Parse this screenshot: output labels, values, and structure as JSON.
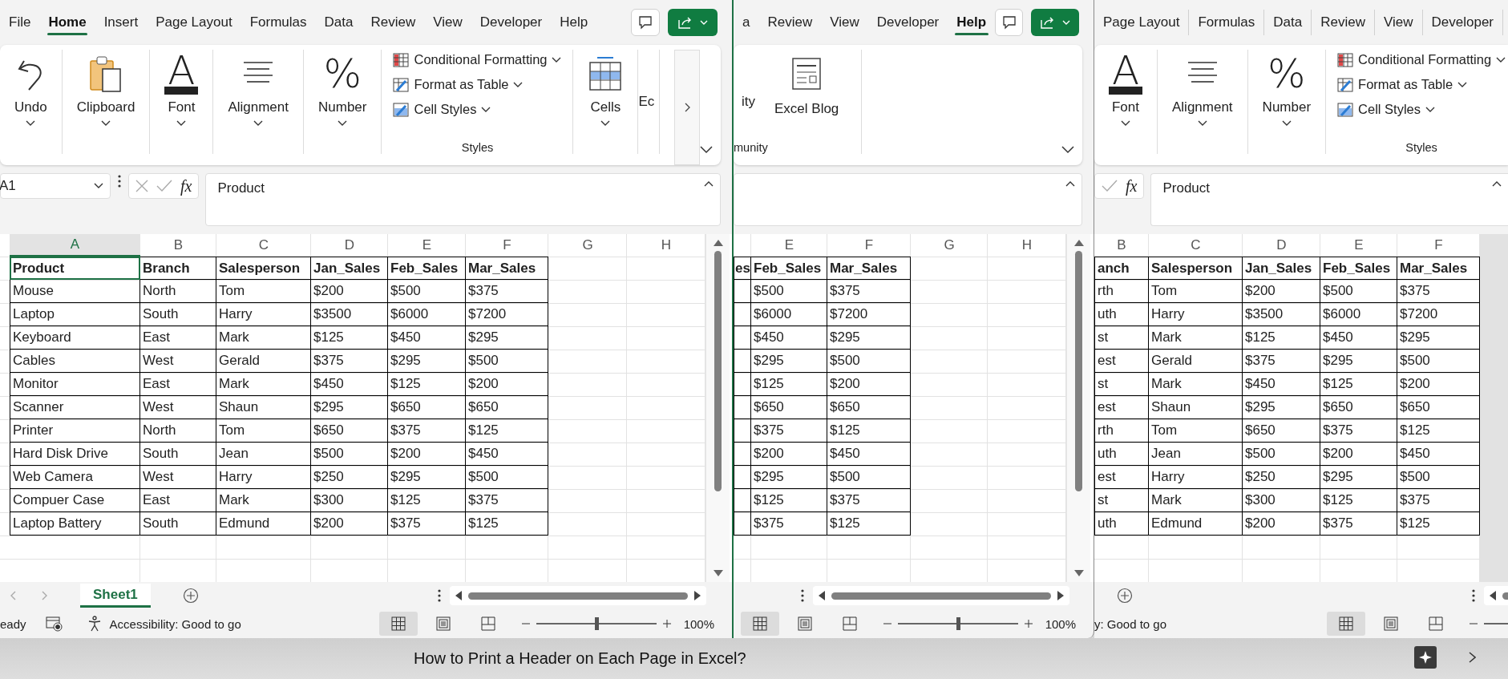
{
  "windows": [
    {
      "active": true,
      "tabs": [
        {
          "label": "File",
          "selected": false
        },
        {
          "label": "Home",
          "selected": true
        },
        {
          "label": "Insert",
          "selected": false
        },
        {
          "label": "Page Layout",
          "selected": false
        },
        {
          "label": "Formulas",
          "selected": false
        },
        {
          "label": "Data",
          "selected": false
        },
        {
          "label": "Review",
          "selected": false
        },
        {
          "label": "View",
          "selected": false
        },
        {
          "label": "Developer",
          "selected": false
        },
        {
          "label": "Help",
          "selected": false
        }
      ],
      "toolbar_buttons": [
        {
          "kind": "comment"
        },
        {
          "kind": "share"
        }
      ],
      "ribbon": [
        {
          "kind": "undo",
          "label": "Undo"
        },
        {
          "kind": "clipboard",
          "label": "Clipboard"
        },
        {
          "kind": "font",
          "label": "Font",
          "glyph": "A"
        },
        {
          "kind": "alignment",
          "label": "Alignment"
        },
        {
          "kind": "number",
          "label": "Number",
          "glyph": "%"
        },
        {
          "kind": "group",
          "label": "Styles",
          "items": [
            {
              "kind": "conditional",
              "label": "Conditional Formatting"
            },
            {
              "kind": "table",
              "label": "Format as Table"
            },
            {
              "kind": "cellstyles",
              "label": "Cell Styles"
            }
          ]
        },
        {
          "kind": "cells",
          "label": "Cells"
        },
        {
          "kind": "partial",
          "label": "Ec"
        }
      ],
      "ribbon_scroll": true,
      "ribbon_collapse": true,
      "formula_bar": {
        "kind": "full",
        "name_box": "A1",
        "fx": "fx",
        "value": "Product"
      },
      "column_letters": [
        {
          "label": "A",
          "selected": true
        },
        {
          "label": "B",
          "selected": false
        },
        {
          "label": "C",
          "selected": false
        },
        {
          "label": "D",
          "selected": false
        },
        {
          "label": "E",
          "selected": false
        },
        {
          "label": "F",
          "selected": false
        },
        {
          "label": "G",
          "selected": false
        },
        {
          "label": "H",
          "selected": false
        }
      ],
      "table": {
        "header": [
          {
            "text": "Product",
            "selected": true
          },
          {
            "text": "Branch",
            "selected": false
          },
          {
            "text": "Salesperson",
            "selected": false
          },
          {
            "text": "Jan_Sales",
            "selected": false
          },
          {
            "text": "Feb_Sales",
            "selected": false
          },
          {
            "text": "Mar_Sales",
            "selected": false
          }
        ],
        "rows": [
          [
            "Mouse",
            "North",
            "Tom",
            "$200",
            "$500",
            "$375"
          ],
          [
            "Laptop",
            "South",
            "Harry",
            "$3500",
            "$6000",
            "$7200"
          ],
          [
            "Keyboard",
            "East",
            "Mark",
            "$125",
            "$450",
            "$295"
          ],
          [
            "Cables",
            "West",
            "Gerald",
            "$375",
            "$295",
            "$500"
          ],
          [
            "Monitor",
            "East",
            "Mark",
            "$450",
            "$125",
            "$200"
          ],
          [
            "Scanner",
            "West",
            "Shaun",
            "$295",
            "$650",
            "$650"
          ],
          [
            "Printer",
            "North",
            "Tom",
            "$650",
            "$375",
            "$125"
          ],
          [
            "Hard Disk Drive",
            "South",
            "Jean",
            "$500",
            "$200",
            "$450"
          ],
          [
            "Web Camera",
            "West",
            "Harry",
            "$250",
            "$295",
            "$500"
          ],
          [
            "Compuer Case",
            "East",
            "Mark",
            "$300",
            "$125",
            "$375"
          ],
          [
            "Laptop Battery",
            "South",
            "Edmund",
            "$200",
            "$375",
            "$125"
          ]
        ]
      },
      "sheet_bar": {
        "kind": "full",
        "tabs": [
          {
            "label": "Sheet1",
            "selected": true
          }
        ]
      },
      "status": {
        "items": [
          {
            "kind": "text",
            "text": "eady"
          },
          {
            "kind": "macro"
          },
          {
            "kind": "accessibility",
            "text": "Accessibility: Good to go"
          }
        ],
        "views": [
          {
            "kind": "normal",
            "selected": true
          },
          {
            "kind": "page_layout",
            "selected": false
          },
          {
            "kind": "page_break",
            "selected": false
          }
        ],
        "zoom": {
          "kind": "full",
          "level": 0.5,
          "reading": "100%"
        }
      }
    },
    {
      "active": false,
      "tabs": [
        {
          "label": "a",
          "selected": false
        },
        {
          "label": "Review",
          "selected": false
        },
        {
          "label": "View",
          "selected": false
        },
        {
          "label": "Developer",
          "selected": false
        },
        {
          "label": "Help",
          "selected": true
        }
      ],
      "toolbar_buttons": [
        {
          "kind": "comment"
        },
        {
          "kind": "share"
        }
      ],
      "ribbon": [
        {
          "kind": "group",
          "label": "munity",
          "items": [
            {
              "kind": "partial",
              "label": "ity"
            },
            {
              "kind": "blog",
              "label": "Excel Blog"
            }
          ]
        }
      ],
      "ribbon_scroll": false,
      "ribbon_collapse": true,
      "formula_bar": {
        "kind": "field_only"
      },
      "column_letters": [
        {
          "label": "E",
          "selected": false
        },
        {
          "label": "F",
          "selected": false
        },
        {
          "label": "G",
          "selected": false
        },
        {
          "label": "H",
          "selected": false
        }
      ],
      "table": {
        "header": [
          {
            "text": "es",
            "selected": false
          },
          {
            "text": "Feb_Sales",
            "selected": false
          },
          {
            "text": "Mar_Sales",
            "selected": false
          }
        ],
        "rows": [
          [
            "$500",
            "$375"
          ],
          [
            "$6000",
            "$7200"
          ],
          [
            "$450",
            "$295"
          ],
          [
            "$295",
            "$500"
          ],
          [
            "$125",
            "$200"
          ],
          [
            "$650",
            "$650"
          ],
          [
            "$375",
            "$125"
          ],
          [
            "$200",
            "$450"
          ],
          [
            "$295",
            "$500"
          ],
          [
            "$125",
            "$375"
          ],
          [
            "$375",
            "$125"
          ]
        ]
      },
      "sheet_bar": {
        "kind": "scroll_only"
      },
      "status": {
        "views": [
          {
            "kind": "normal",
            "selected": true
          },
          {
            "kind": "page_layout",
            "selected": false
          },
          {
            "kind": "page_break",
            "selected": false
          }
        ],
        "zoom": {
          "kind": "full",
          "level": 0.5,
          "reading": "100%"
        }
      }
    },
    {
      "active": false,
      "tabs": [
        {
          "label": "Page Layout",
          "selected": false
        },
        {
          "label": "Formulas",
          "selected": false
        },
        {
          "label": "Data",
          "selected": false
        },
        {
          "label": "Review",
          "selected": false
        },
        {
          "label": "View",
          "selected": false
        },
        {
          "label": "Developer",
          "selected": false
        }
      ],
      "ribbon": [
        {
          "kind": "font",
          "label": "Font",
          "glyph": "A"
        },
        {
          "kind": "alignment",
          "label": "Alignment"
        },
        {
          "kind": "number",
          "label": "Number",
          "glyph": "%"
        },
        {
          "kind": "group",
          "label": "Styles",
          "items": [
            {
              "kind": "conditional",
              "label": "Conditional Formatting"
            },
            {
              "kind": "table",
              "label": "Format as Table"
            },
            {
              "kind": "cellstyles",
              "label": "Cell Styles"
            }
          ]
        }
      ],
      "ribbon_scroll": false,
      "ribbon_collapse": false,
      "formula_bar": {
        "kind": "fx_only",
        "fx": "fx",
        "value": "Product"
      },
      "column_letters": [
        {
          "label": "B",
          "selected": false
        },
        {
          "label": "C",
          "selected": false
        },
        {
          "label": "D",
          "selected": false
        },
        {
          "label": "E",
          "selected": false
        },
        {
          "label": "F",
          "selected": false
        }
      ],
      "table": {
        "header": [
          {
            "text": "anch",
            "selected": false
          },
          {
            "text": "Salesperson",
            "selected": false
          },
          {
            "text": "Jan_Sales",
            "selected": false
          },
          {
            "text": "Feb_Sales",
            "selected": false
          },
          {
            "text": "Mar_Sales",
            "selected": false
          }
        ],
        "rows": [
          [
            "rth",
            "Tom",
            "$200",
            "$500",
            "$375"
          ],
          [
            "uth",
            "Harry",
            "$3500",
            "$6000",
            "$7200"
          ],
          [
            "st",
            "Mark",
            "$125",
            "$450",
            "$295"
          ],
          [
            "est",
            "Gerald",
            "$375",
            "$295",
            "$500"
          ],
          [
            "st",
            "Mark",
            "$450",
            "$125",
            "$200"
          ],
          [
            "est",
            "Shaun",
            "$295",
            "$650",
            "$650"
          ],
          [
            "rth",
            "Tom",
            "$650",
            "$375",
            "$125"
          ],
          [
            "uth",
            "Jean",
            "$500",
            "$200",
            "$450"
          ],
          [
            "est",
            "Harry",
            "$250",
            "$295",
            "$500"
          ],
          [
            "st",
            "Mark",
            "$300",
            "$125",
            "$375"
          ],
          [
            "uth",
            "Edmund",
            "$200",
            "$375",
            "$125"
          ]
        ]
      },
      "sheet_bar": {
        "kind": "add_only"
      },
      "status": {
        "items": [
          {
            "kind": "text",
            "text": "y: Good to go"
          }
        ],
        "views": [
          {
            "kind": "normal",
            "selected": true
          },
          {
            "kind": "page_layout",
            "selected": false
          },
          {
            "kind": "page_break",
            "selected": false
          }
        ],
        "zoom": {
          "kind": "cut"
        }
      }
    }
  ],
  "caption": "How to Print a Header on Each Page in Excel?"
}
